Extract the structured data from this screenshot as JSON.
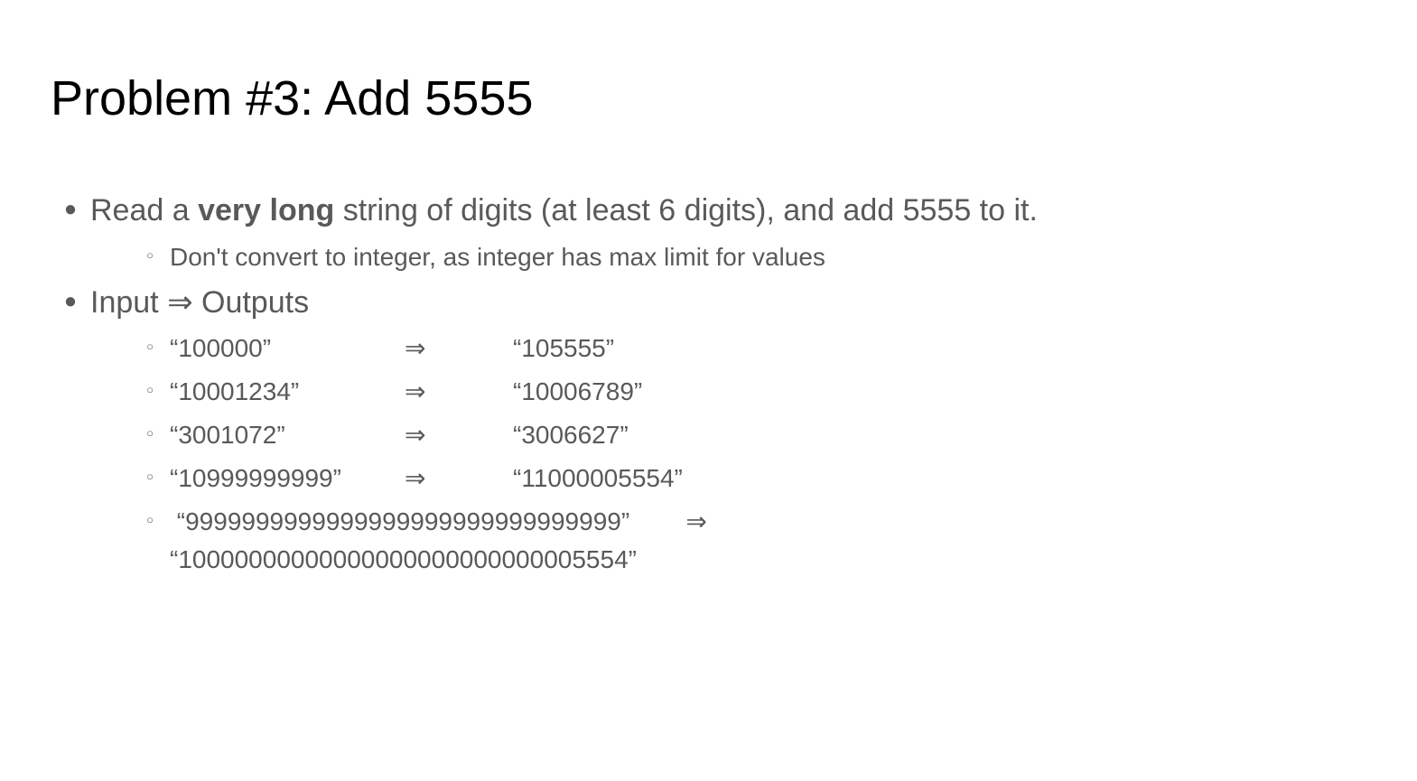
{
  "title": "Problem #3: Add 5555",
  "main_bullets": [
    {
      "text_before": "Read a ",
      "text_bold": "very long",
      "text_after": " string of digits (at least 6 digits), and add 5555 to it."
    }
  ],
  "sub_note": "Don't convert to integer, as integer has max limit for values",
  "io_heading": "Input ⇒ Outputs",
  "examples": [
    {
      "input": "“100000”",
      "arrow": "⇒",
      "output": "“105555”"
    },
    {
      "input": "“10001234”",
      "arrow": "⇒",
      "output": "“10006789”"
    },
    {
      "input": "“3001072”",
      "arrow": "⇒",
      "output": "“3006627”"
    },
    {
      "input": "“10999999999”",
      "arrow": "⇒",
      "output": "“11000005554”"
    }
  ],
  "long_example": {
    "input": "“9999999999999999999999999999999”",
    "arrow": "⇒",
    "output": "“10000000000000000000000000005554”"
  }
}
